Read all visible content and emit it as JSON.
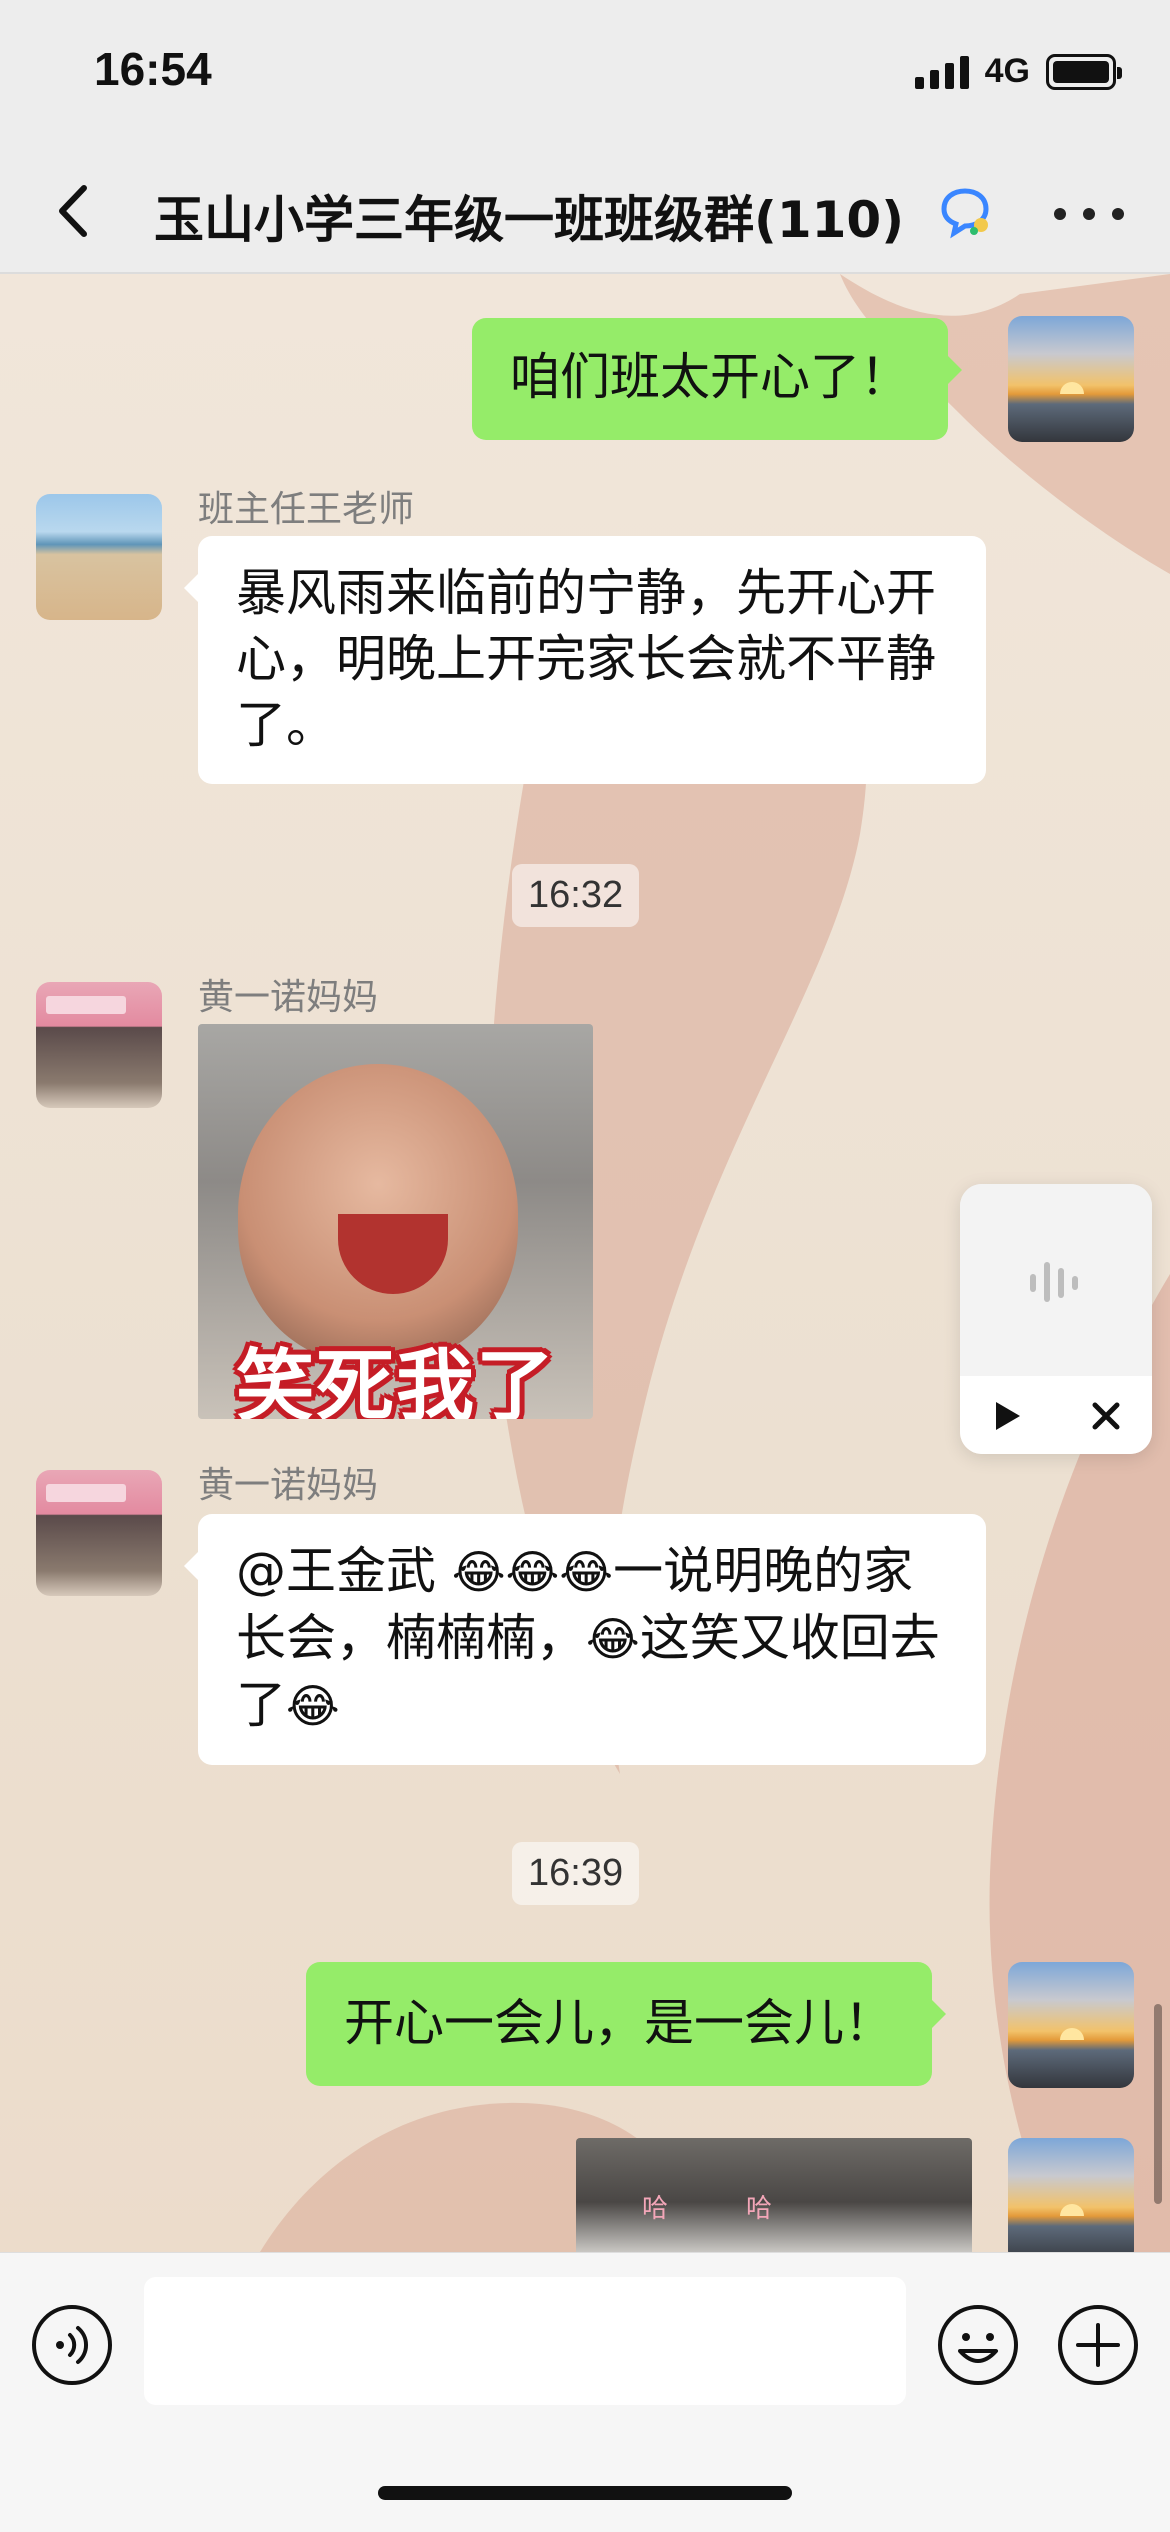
{
  "status": {
    "time": "16:54",
    "network": "4G"
  },
  "header": {
    "title": "玉山小学三年级一班班级群(110)"
  },
  "messages": [
    {
      "type": "text",
      "direction": "out",
      "text": "咱们班太开心了！"
    },
    {
      "type": "text",
      "direction": "in",
      "sender": "班主任王老师",
      "text": "暴风雨来临前的宁静，先开心开心，明晚上开完家长会就不平静了。"
    },
    {
      "type": "time",
      "text": "16:32"
    },
    {
      "type": "sticker",
      "direction": "in",
      "sender": "黄一诺妈妈",
      "caption": "笑死我了"
    },
    {
      "type": "text",
      "direction": "in",
      "sender": "黄一诺妈妈",
      "text_parts": [
        "@王金武 ",
        "😂😂😂",
        "一说明晚的家长会，楠楠楠，",
        "😂",
        "这笑又收回去了",
        "😂"
      ]
    },
    {
      "type": "time",
      "text": "16:39"
    },
    {
      "type": "text",
      "direction": "out",
      "text": "开心一会儿，是一会儿！"
    },
    {
      "type": "video",
      "direction": "out",
      "overlay": [
        "哈",
        "哈"
      ]
    }
  ],
  "icons": {
    "back": "chevron-left-icon",
    "title_badge": "chat-bubble-badge-icon",
    "more": "more-dots-icon",
    "voice_widget": "sound-wave-icon",
    "play": "play-icon",
    "close": "close-icon",
    "voice_input": "voice-input-icon",
    "emoji": "emoji-icon",
    "plus": "plus-icon"
  },
  "colors": {
    "nav_bg": "#ededed",
    "bubble_out": "#95ec69",
    "bubble_in": "#ffffff",
    "chat_bg": "#efe3d5"
  }
}
